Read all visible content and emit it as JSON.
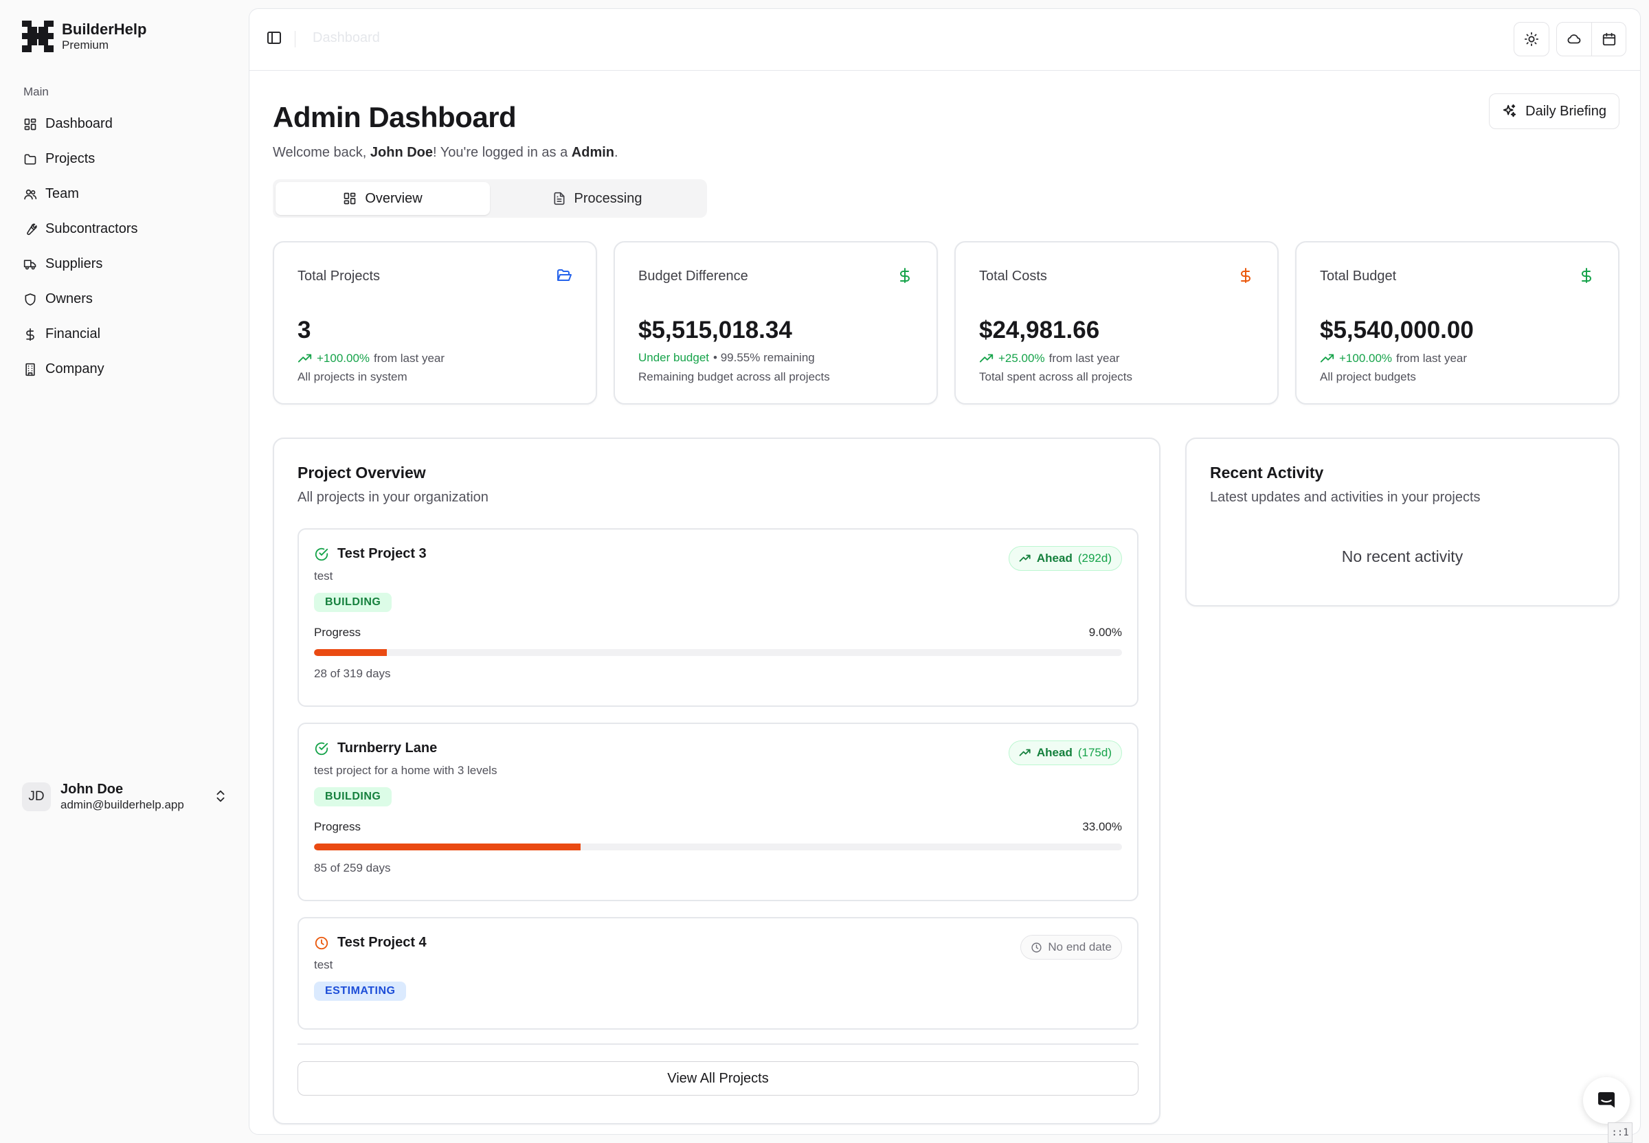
{
  "brand": {
    "name": "BuilderHelp",
    "plan": "Premium"
  },
  "sidebar": {
    "section_label": "Main",
    "items": [
      {
        "label": "Dashboard",
        "icon": "dashboard-grid-icon"
      },
      {
        "label": "Projects",
        "icon": "folder-icon"
      },
      {
        "label": "Team",
        "icon": "users-icon"
      },
      {
        "label": "Subcontractors",
        "icon": "wrench-icon"
      },
      {
        "label": "Suppliers",
        "icon": "truck-icon"
      },
      {
        "label": "Owners",
        "icon": "shield-icon"
      },
      {
        "label": "Financial",
        "icon": "dollar-icon"
      },
      {
        "label": "Company",
        "icon": "building-icon"
      }
    ]
  },
  "user": {
    "initials": "JD",
    "name": "John Doe",
    "email": "admin@builderhelp.app"
  },
  "topbar": {
    "breadcrumb": "Dashboard"
  },
  "page": {
    "title": "Admin Dashboard",
    "welcome_prefix": "Welcome back, ",
    "welcome_name": "John Doe",
    "welcome_middle": "! You're logged in as a ",
    "welcome_role": "Admin",
    "welcome_suffix": ".",
    "briefing_label": "Daily Briefing"
  },
  "tabs": [
    {
      "label": "Overview",
      "active": true
    },
    {
      "label": "Processing",
      "active": false
    }
  ],
  "stats": [
    {
      "title": "Total Projects",
      "value": "3",
      "trend": "+100.00%",
      "trend_suffix": " from last year",
      "subtitle": "All projects in system",
      "icon": "folder-open-icon",
      "icon_color": "#2563eb"
    },
    {
      "title": "Budget Difference",
      "value": "$5,515,018.34",
      "status": "Under budget",
      "status_suffix": " • 99.55% remaining",
      "subtitle": "Remaining budget across all projects",
      "icon": "dollar-icon",
      "icon_color": "#16a34a"
    },
    {
      "title": "Total Costs",
      "value": "$24,981.66",
      "trend": "+25.00%",
      "trend_suffix": " from last year",
      "subtitle": "Total spent across all projects",
      "icon": "dollar-icon",
      "icon_color": "#ea580c"
    },
    {
      "title": "Total Budget",
      "value": "$5,540,000.00",
      "trend": "+100.00%",
      "trend_suffix": " from last year",
      "subtitle": "All project budgets",
      "icon": "dollar-icon",
      "icon_color": "#16a34a"
    }
  ],
  "project_overview": {
    "title": "Project Overview",
    "subtitle": "All projects in your organization",
    "progress_label": "Progress",
    "projects": [
      {
        "name": "Test Project 3",
        "description": "test",
        "status": "BUILDING",
        "schedule": "Ahead",
        "schedule_days": "(292d)",
        "progress_pct": "9.00%",
        "progress": 0.09,
        "days": "28 of 319 days"
      },
      {
        "name": "Turnberry Lane",
        "description": "test project for a home with 3 levels",
        "status": "BUILDING",
        "schedule": "Ahead",
        "schedule_days": "(175d)",
        "progress_pct": "33.00%",
        "progress": 0.33,
        "days": "85 of 259 days"
      },
      {
        "name": "Test Project 4",
        "description": "test",
        "status": "ESTIMATING",
        "schedule": "No end date"
      }
    ],
    "view_all_label": "View All Projects"
  },
  "recent_activity": {
    "title": "Recent Activity",
    "subtitle": "Latest updates and activities in your projects",
    "empty": "No recent activity"
  },
  "corner_tag": "::1"
}
